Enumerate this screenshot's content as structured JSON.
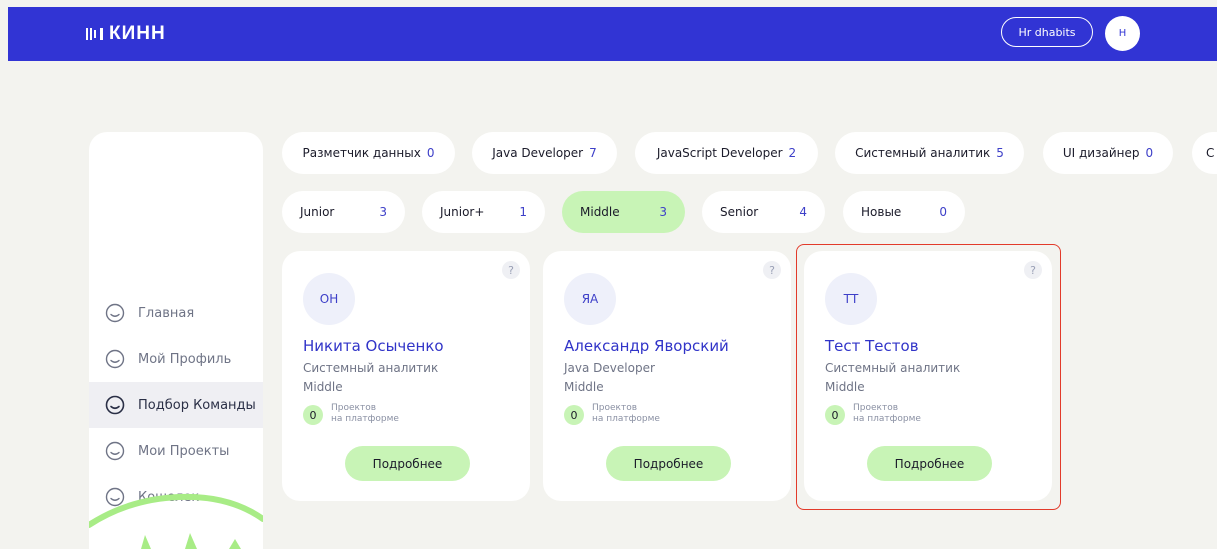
{
  "header": {
    "logo_text": "КИНН",
    "hr_button_label": "Hr dhabits",
    "avatar_initial": "H",
    "color": "#3134d4"
  },
  "sidebar": {
    "items": [
      {
        "label": "Главная",
        "icon": "smiley-icon",
        "active": false
      },
      {
        "label": "Мой Профиль",
        "icon": "smiley-icon",
        "active": false
      },
      {
        "label": "Подбор Команды",
        "icon": "smiley-icon",
        "active": true
      },
      {
        "label": "Мои Проекты",
        "icon": "smiley-icon",
        "active": false
      },
      {
        "label": "Кошелек",
        "icon": "smiley-icon",
        "active": false
      }
    ]
  },
  "role_filters": [
    {
      "label": "Разметчик данных",
      "count": "0"
    },
    {
      "label": "Java Developer",
      "count": "7"
    },
    {
      "label": "JavaScript Developer",
      "count": "2"
    },
    {
      "label": "Системный аналитик",
      "count": "5"
    },
    {
      "label": "UI дизайнер",
      "count": "0"
    },
    {
      "label": "С",
      "count": ""
    }
  ],
  "level_filters": [
    {
      "label": "Junior",
      "count": "3",
      "selected": false
    },
    {
      "label": "Junior+",
      "count": "1",
      "selected": false
    },
    {
      "label": "Middle",
      "count": "3",
      "selected": true
    },
    {
      "label": "Senior",
      "count": "4",
      "selected": false
    },
    {
      "label": "Новые",
      "count": "0",
      "selected": false
    }
  ],
  "cards": [
    {
      "initials": "ОН",
      "name": "Никита Осыченко",
      "role": "Системный аналитик",
      "level": "Middle",
      "projects_count": "0",
      "projects_line1": "Проектов",
      "projects_line2": "на платформе",
      "button": "Подробнее",
      "help": "?"
    },
    {
      "initials": "ЯА",
      "name": "Александр Яворский",
      "role": "Java Developer",
      "level": "Middle",
      "projects_count": "0",
      "projects_line1": "Проектов",
      "projects_line2": "на платформе",
      "button": "Подробнее",
      "help": "?"
    },
    {
      "initials": "ТТ",
      "name": "Тест Тестов",
      "role": "Системный аналитик",
      "level": "Middle",
      "projects_count": "0",
      "projects_line1": "Проектов",
      "projects_line2": "на платформе",
      "button": "Подробнее",
      "help": "?"
    }
  ],
  "colors": {
    "accent_green": "#c8f4b6",
    "highlight_red": "#e23a2a",
    "background": "#f3f3ef"
  }
}
